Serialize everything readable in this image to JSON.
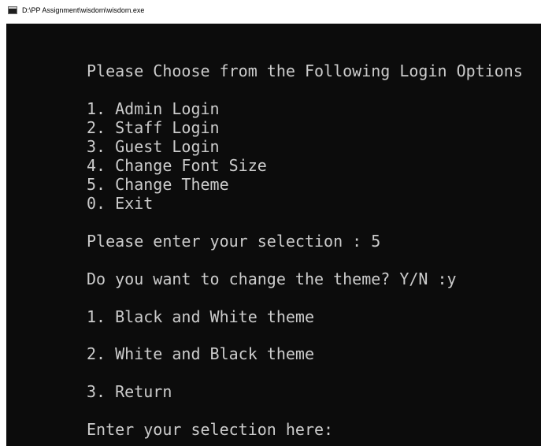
{
  "window": {
    "title": "D:\\PP Assignment\\wisdom\\wisdom.exe",
    "icon": "console-app-icon"
  },
  "console": {
    "background": "#0c0c0c",
    "foreground": "#cccccc",
    "lines": [
      "Please Choose from the Following Login Options",
      "1. Admin Login",
      "2. Staff Login",
      "3. Guest Login",
      "4. Change Font Size",
      "5. Change Theme",
      "0. Exit",
      "Please enter your selection : 5",
      "Do you want to change the theme? Y/N :y",
      "1. Black and White theme",
      "2. White and Black theme",
      "3. Return",
      "Enter your selection here:"
    ]
  }
}
